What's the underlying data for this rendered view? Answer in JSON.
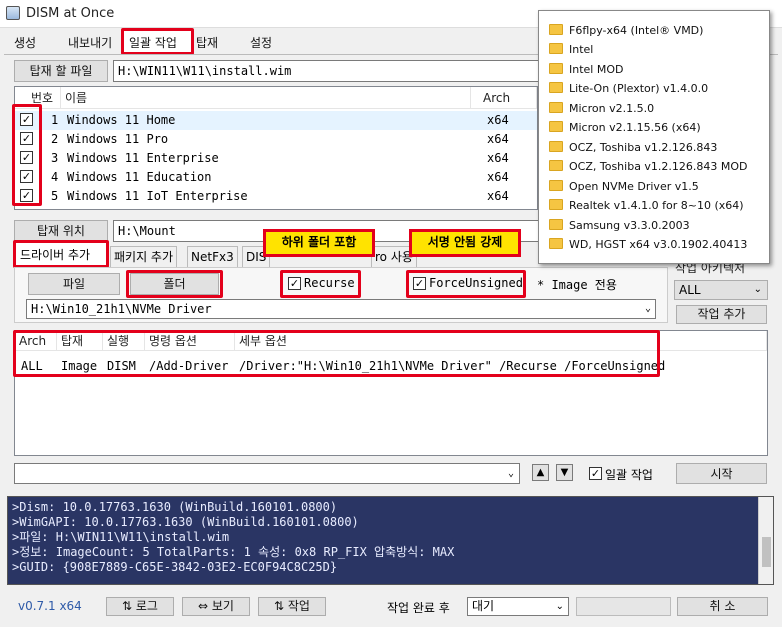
{
  "window": {
    "title": "DISM at Once"
  },
  "menu": [
    "생성",
    "내보내기",
    "일괄 작업",
    "탑재",
    "설정"
  ],
  "mount_file": {
    "button": "탑재 할 파일",
    "value": "H:\\WIN11\\W11\\install.wim"
  },
  "image_list": {
    "headers": [
      "번호",
      "이름",
      "Arch"
    ],
    "rows": [
      {
        "num": "1",
        "name": "Windows 11 Home",
        "arch": "x64"
      },
      {
        "num": "2",
        "name": "Windows 11 Pro",
        "arch": "x64"
      },
      {
        "num": "3",
        "name": "Windows 11 Enterprise",
        "arch": "x64"
      },
      {
        "num": "4",
        "name": "Windows 11 Education",
        "arch": "x64"
      },
      {
        "num": "5",
        "name": "Windows 11 IoT Enterprise",
        "arch": "x64"
      }
    ]
  },
  "mount_location": {
    "button": "탑재 위치",
    "value": "H:\\Mount"
  },
  "tabs": [
    "드라이버 추가",
    "패키지 추가",
    "NetFx3",
    "DIS",
    "ro 사용"
  ],
  "driver": {
    "file_button": "파일",
    "folder_button": "폴더",
    "recurse": "Recurse",
    "force_unsigned": "ForceUnsigned",
    "image_only": "* Image 전용",
    "path": "H:\\Win10_21h1\\NVMe Driver"
  },
  "callouts": {
    "recurse": "하위 폴더 포함",
    "force": "서명 안됨 강제"
  },
  "right_panel": {
    "group_label": "작업 아키텍처",
    "arch_value": "ALL",
    "add_job_button": "작업 추가"
  },
  "job_table": {
    "headers": [
      "Arch",
      "탑재",
      "실행",
      "명령 옵션",
      "세부 옵션"
    ],
    "rows": [
      {
        "arch": "ALL",
        "mount": "Image",
        "exec": "DISM",
        "cmd": "/Add-Driver",
        "detail": "/Driver:\"H:\\Win10_21h1\\NVMe Driver\" /Recurse /ForceUnsigned"
      }
    ]
  },
  "bottom_controls": {
    "up": "▲",
    "down": "▼",
    "batch_label": "일괄 작업",
    "start_button": "시작"
  },
  "console_lines": [
    ">Dism: 10.0.17763.1630 (WinBuild.160101.0800)",
    ">WimGAPI: 10.0.17763.1630 (WinBuild.160101.0800)",
    ">파일: H:\\WIN11\\W11\\install.wim",
    ">정보: ImageCount: 5  TotalParts: 1  속성: 0x8 RP_FIX  압축방식: MAX",
    ">GUID: {908E7889-C65E-3842-03E2-EC0F94C8C25D}"
  ],
  "status_bar": {
    "version": "v0.7.1 x64",
    "log_button": "⇅ 로그",
    "view_button": "⇔ 보기",
    "job_button": "⇅ 작업",
    "after_label": "작업 완료 후",
    "after_value": "대기",
    "cancel_button": "취 소"
  },
  "folder_popup": [
    "F6flpy-x64 (Intel® VMD)",
    "Intel",
    "Intel MOD",
    "Lite-On (Plextor) v1.4.0.0",
    "Micron v2.1.5.0",
    "Micron v2.1.15.56 (x64)",
    "OCZ, Toshiba v1.2.126.843",
    "OCZ, Toshiba v1.2.126.843 MOD",
    "Open NVMe Driver v1.5",
    "Realtek v1.4.1.0 for 8~10 (x64)",
    "Samsung v3.3.0.2003",
    "WD, HGST x64 v3.0.1902.40413"
  ],
  "colors": {
    "accent_red": "#e3001b",
    "callout_yellow": "#ffe300",
    "console_bg": "#2a3564"
  }
}
